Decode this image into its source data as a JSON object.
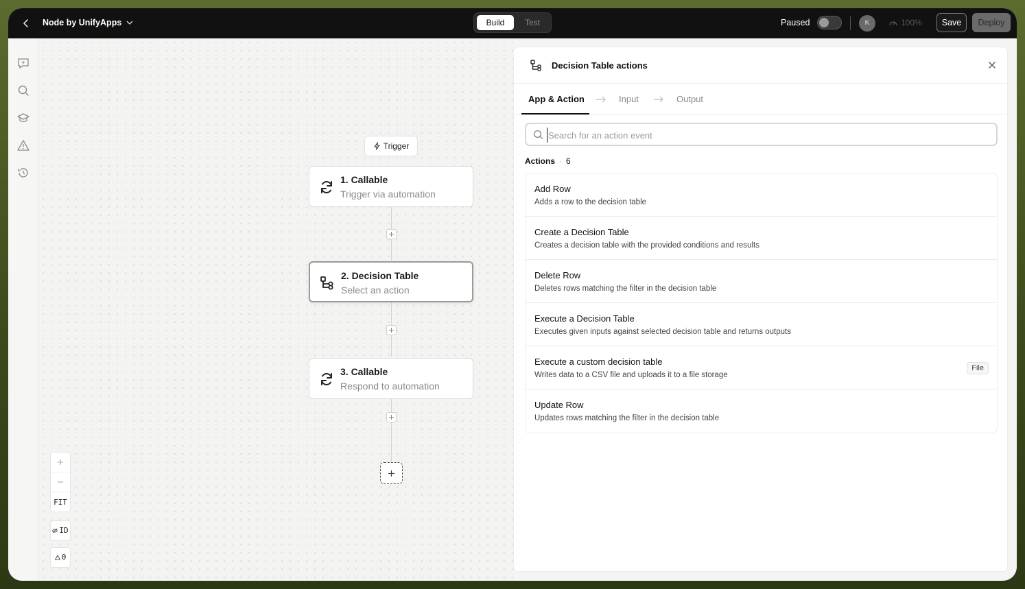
{
  "topbar": {
    "app_title": "Node by UnifyApps",
    "mode_build": "Build",
    "mode_test": "Test",
    "paused_label": "Paused",
    "avatar_initial": "K",
    "zoom": "100%",
    "save_label": "Save",
    "deploy_label": "Deploy"
  },
  "canvas": {
    "trigger_label": "Trigger",
    "nodes": [
      {
        "title": "1. Callable",
        "subtitle": "Trigger via automation",
        "icon": "refresh-icon"
      },
      {
        "title": "2. Decision Table",
        "subtitle": "Select an action",
        "icon": "decision-table-icon"
      },
      {
        "title": "3. Callable",
        "subtitle": "Respond to automation",
        "icon": "refresh-icon"
      }
    ],
    "controls": {
      "fit": "FIT",
      "id": "ID",
      "warnings": "0"
    }
  },
  "panel": {
    "title": "Decision Table actions",
    "tabs": [
      {
        "label": "App & Action",
        "active": true
      },
      {
        "label": "Input",
        "active": false
      },
      {
        "label": "Output",
        "active": false
      }
    ],
    "search": {
      "placeholder": "Search for an action event",
      "value": ""
    },
    "actions_label": "Actions",
    "actions_count": "6",
    "actions": [
      {
        "name": "Add Row",
        "description": "Adds a row to the decision table",
        "badge": ""
      },
      {
        "name": "Create a Decision Table",
        "description": "Creates a decision table with the provided conditions and results",
        "badge": ""
      },
      {
        "name": "Delete Row",
        "description": "Deletes rows matching the filter in the decision table",
        "badge": ""
      },
      {
        "name": "Execute a Decision Table",
        "description": "Executes given inputs against selected decision table and returns outputs",
        "badge": ""
      },
      {
        "name": "Execute a custom decision table",
        "description": "Writes data to a CSV file and uploads it to a file storage",
        "badge": "File"
      },
      {
        "name": "Update Row",
        "description": "Updates rows matching the filter in the decision table",
        "badge": ""
      }
    ]
  },
  "colors": {
    "topbar": "#111111",
    "canvas": "#f3f3f1",
    "panel": "#ffffff",
    "accent": "#111111"
  }
}
